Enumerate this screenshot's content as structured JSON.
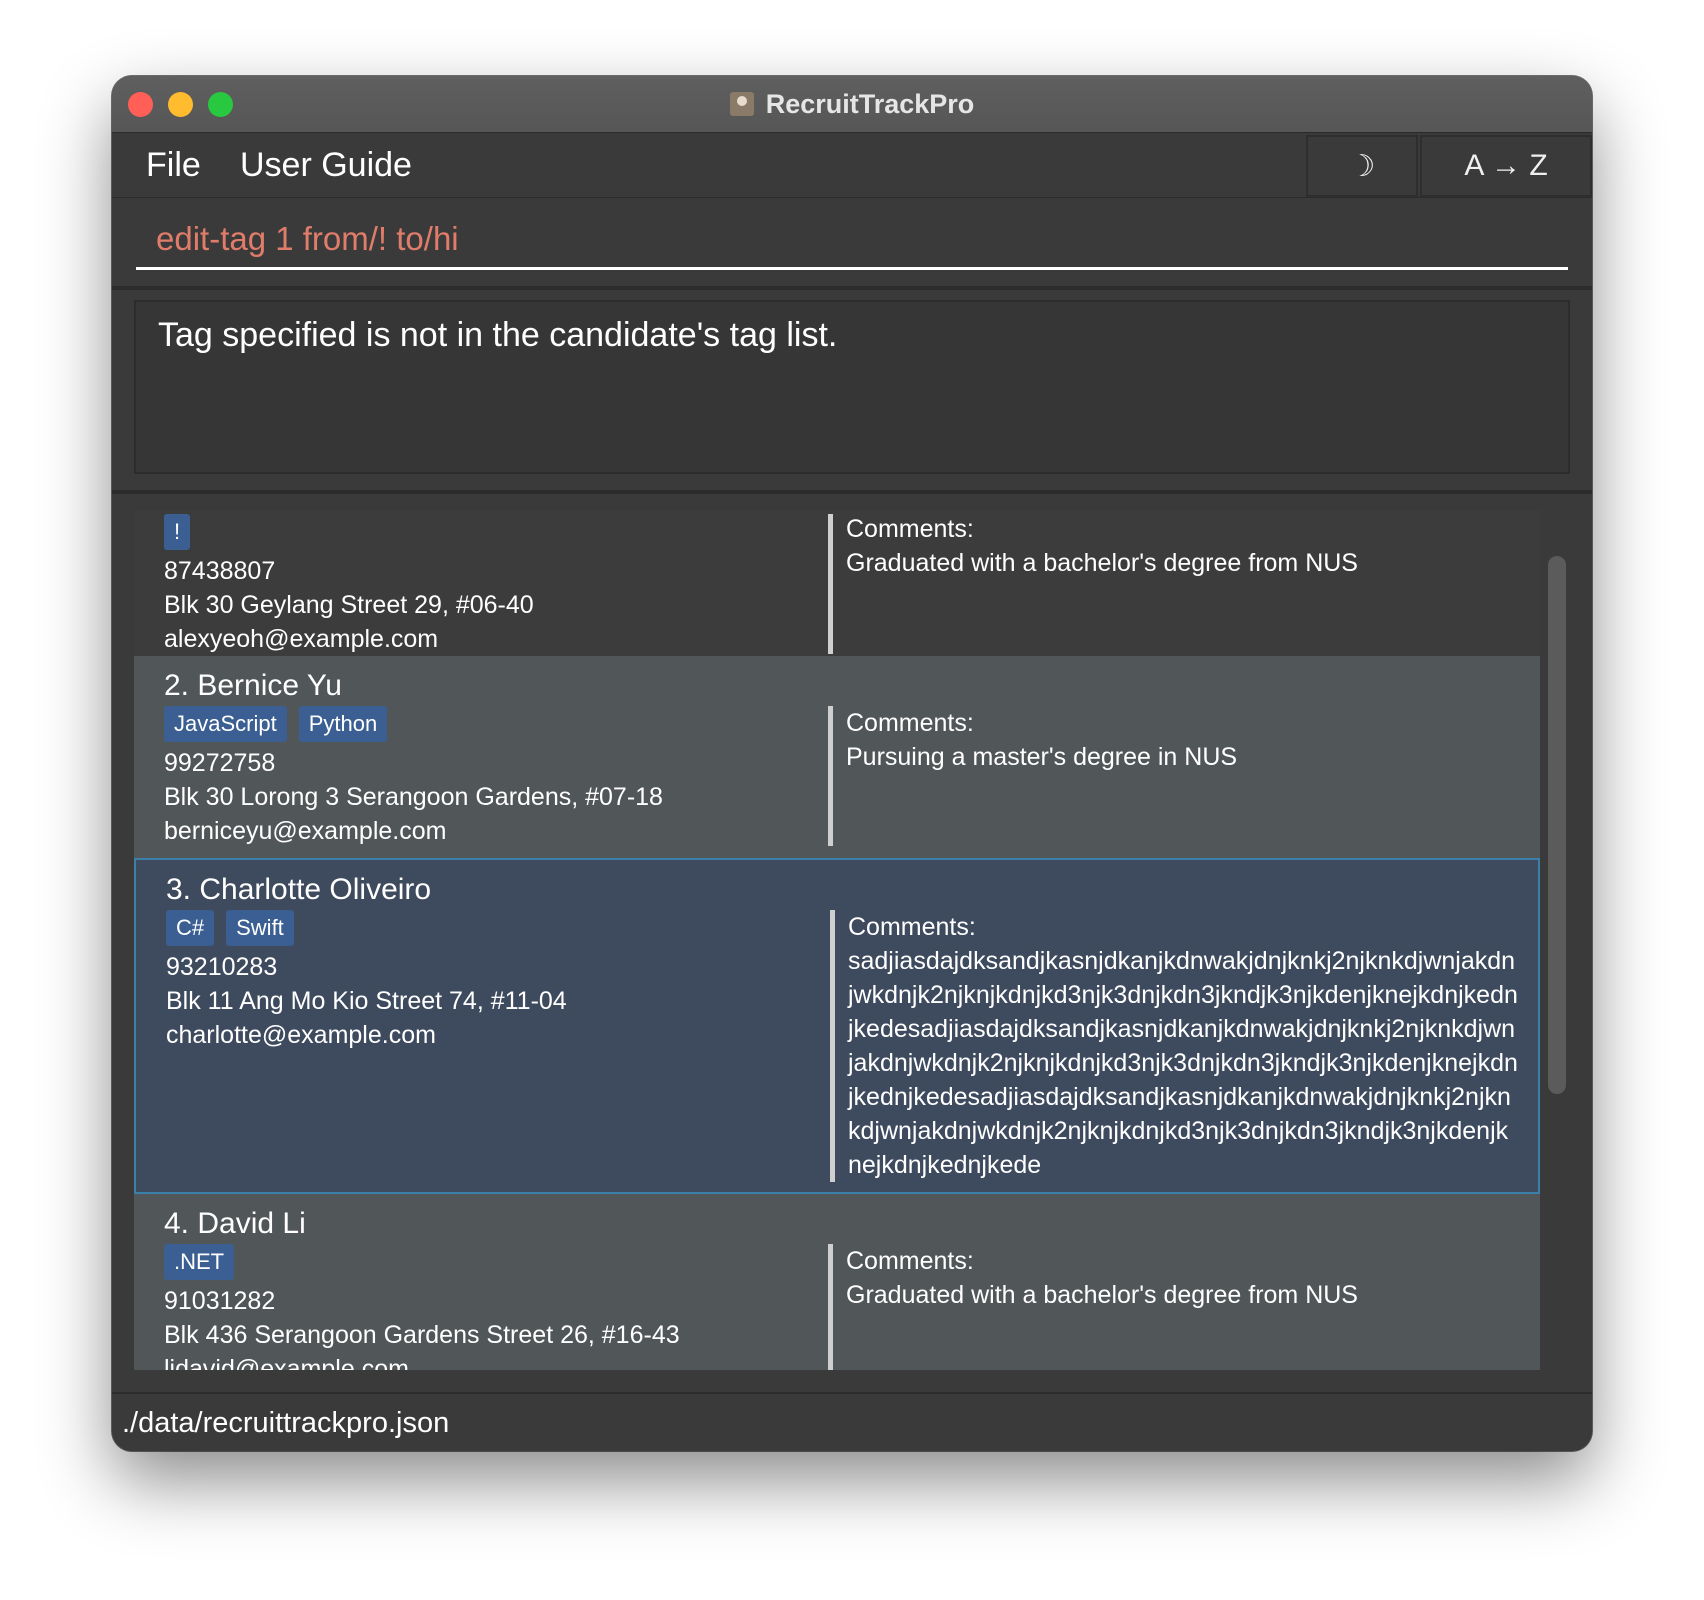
{
  "window": {
    "title": "RecruitTrackPro"
  },
  "menu": {
    "file": "File",
    "user_guide": "User Guide"
  },
  "toolbar": {
    "theme_label": "☽",
    "sort_label": "A → Z"
  },
  "command": {
    "value": "edit-tag 1 from/! to/hi"
  },
  "result": {
    "message": "Tag specified is not in the candidate's tag list."
  },
  "comments_label": "Comments:",
  "candidates": [
    {
      "name": "",
      "tags": [
        "!"
      ],
      "phone": "87438807",
      "address": "Blk 30 Geylang Street 29, #06-40",
      "email": "alexyeoh@example.com",
      "comments": "Graduated with a bachelor's degree from NUS"
    },
    {
      "name": "2. Bernice Yu",
      "tags": [
        "JavaScript",
        "Python"
      ],
      "phone": "99272758",
      "address": "Blk 30 Lorong 3 Serangoon Gardens, #07-18",
      "email": "berniceyu@example.com",
      "comments": "Pursuing a master's degree in NUS"
    },
    {
      "name": "3. Charlotte Oliveiro",
      "tags": [
        "C#",
        "Swift"
      ],
      "phone": "93210283",
      "address": "Blk 11 Ang Mo Kio Street 74, #11-04",
      "email": "charlotte@example.com",
      "comments": "sadjiasdajdksandjkasnjdkanjkdnwakjdnjknkj2njknkdjwnjakdnjwkdnjk2njknjkdnjkd3njk3dnjkdn3jkndjk3njkdenjknejkdnjkednjkedesadjiasdajdksandjkasnjdkanjkdnwakjdnjknkj2njknkdjwnjakdnjwkdnjk2njknjkdnjkd3njk3dnjkdn3jkndjk3njkdenjknejkdnjkednjkedesadjiasdajdksandjkasnjdkanjkdnwakjdnjknkj2njknkdjwnjakdnjwkdnjk2njknjkdnjkd3njk3dnjkdn3jkndjk3njkdenjknejkdnjkednjkede"
    },
    {
      "name": "4. David Li",
      "tags": [
        ".NET"
      ],
      "phone": "91031282",
      "address": "Blk 436 Serangoon Gardens Street 26, #16-43",
      "email": "lidavid@example.com",
      "comments": "Graduated with a bachelor's degree from NUS"
    }
  ],
  "status": {
    "path": "./data/recruittrackpro.json"
  },
  "colors": {
    "background": "#3a3a3a",
    "command_text": "#e07d6a",
    "tag": "#3b5f92",
    "selected_card": "#3e4a5e",
    "selected_border": "#3b80a8"
  }
}
